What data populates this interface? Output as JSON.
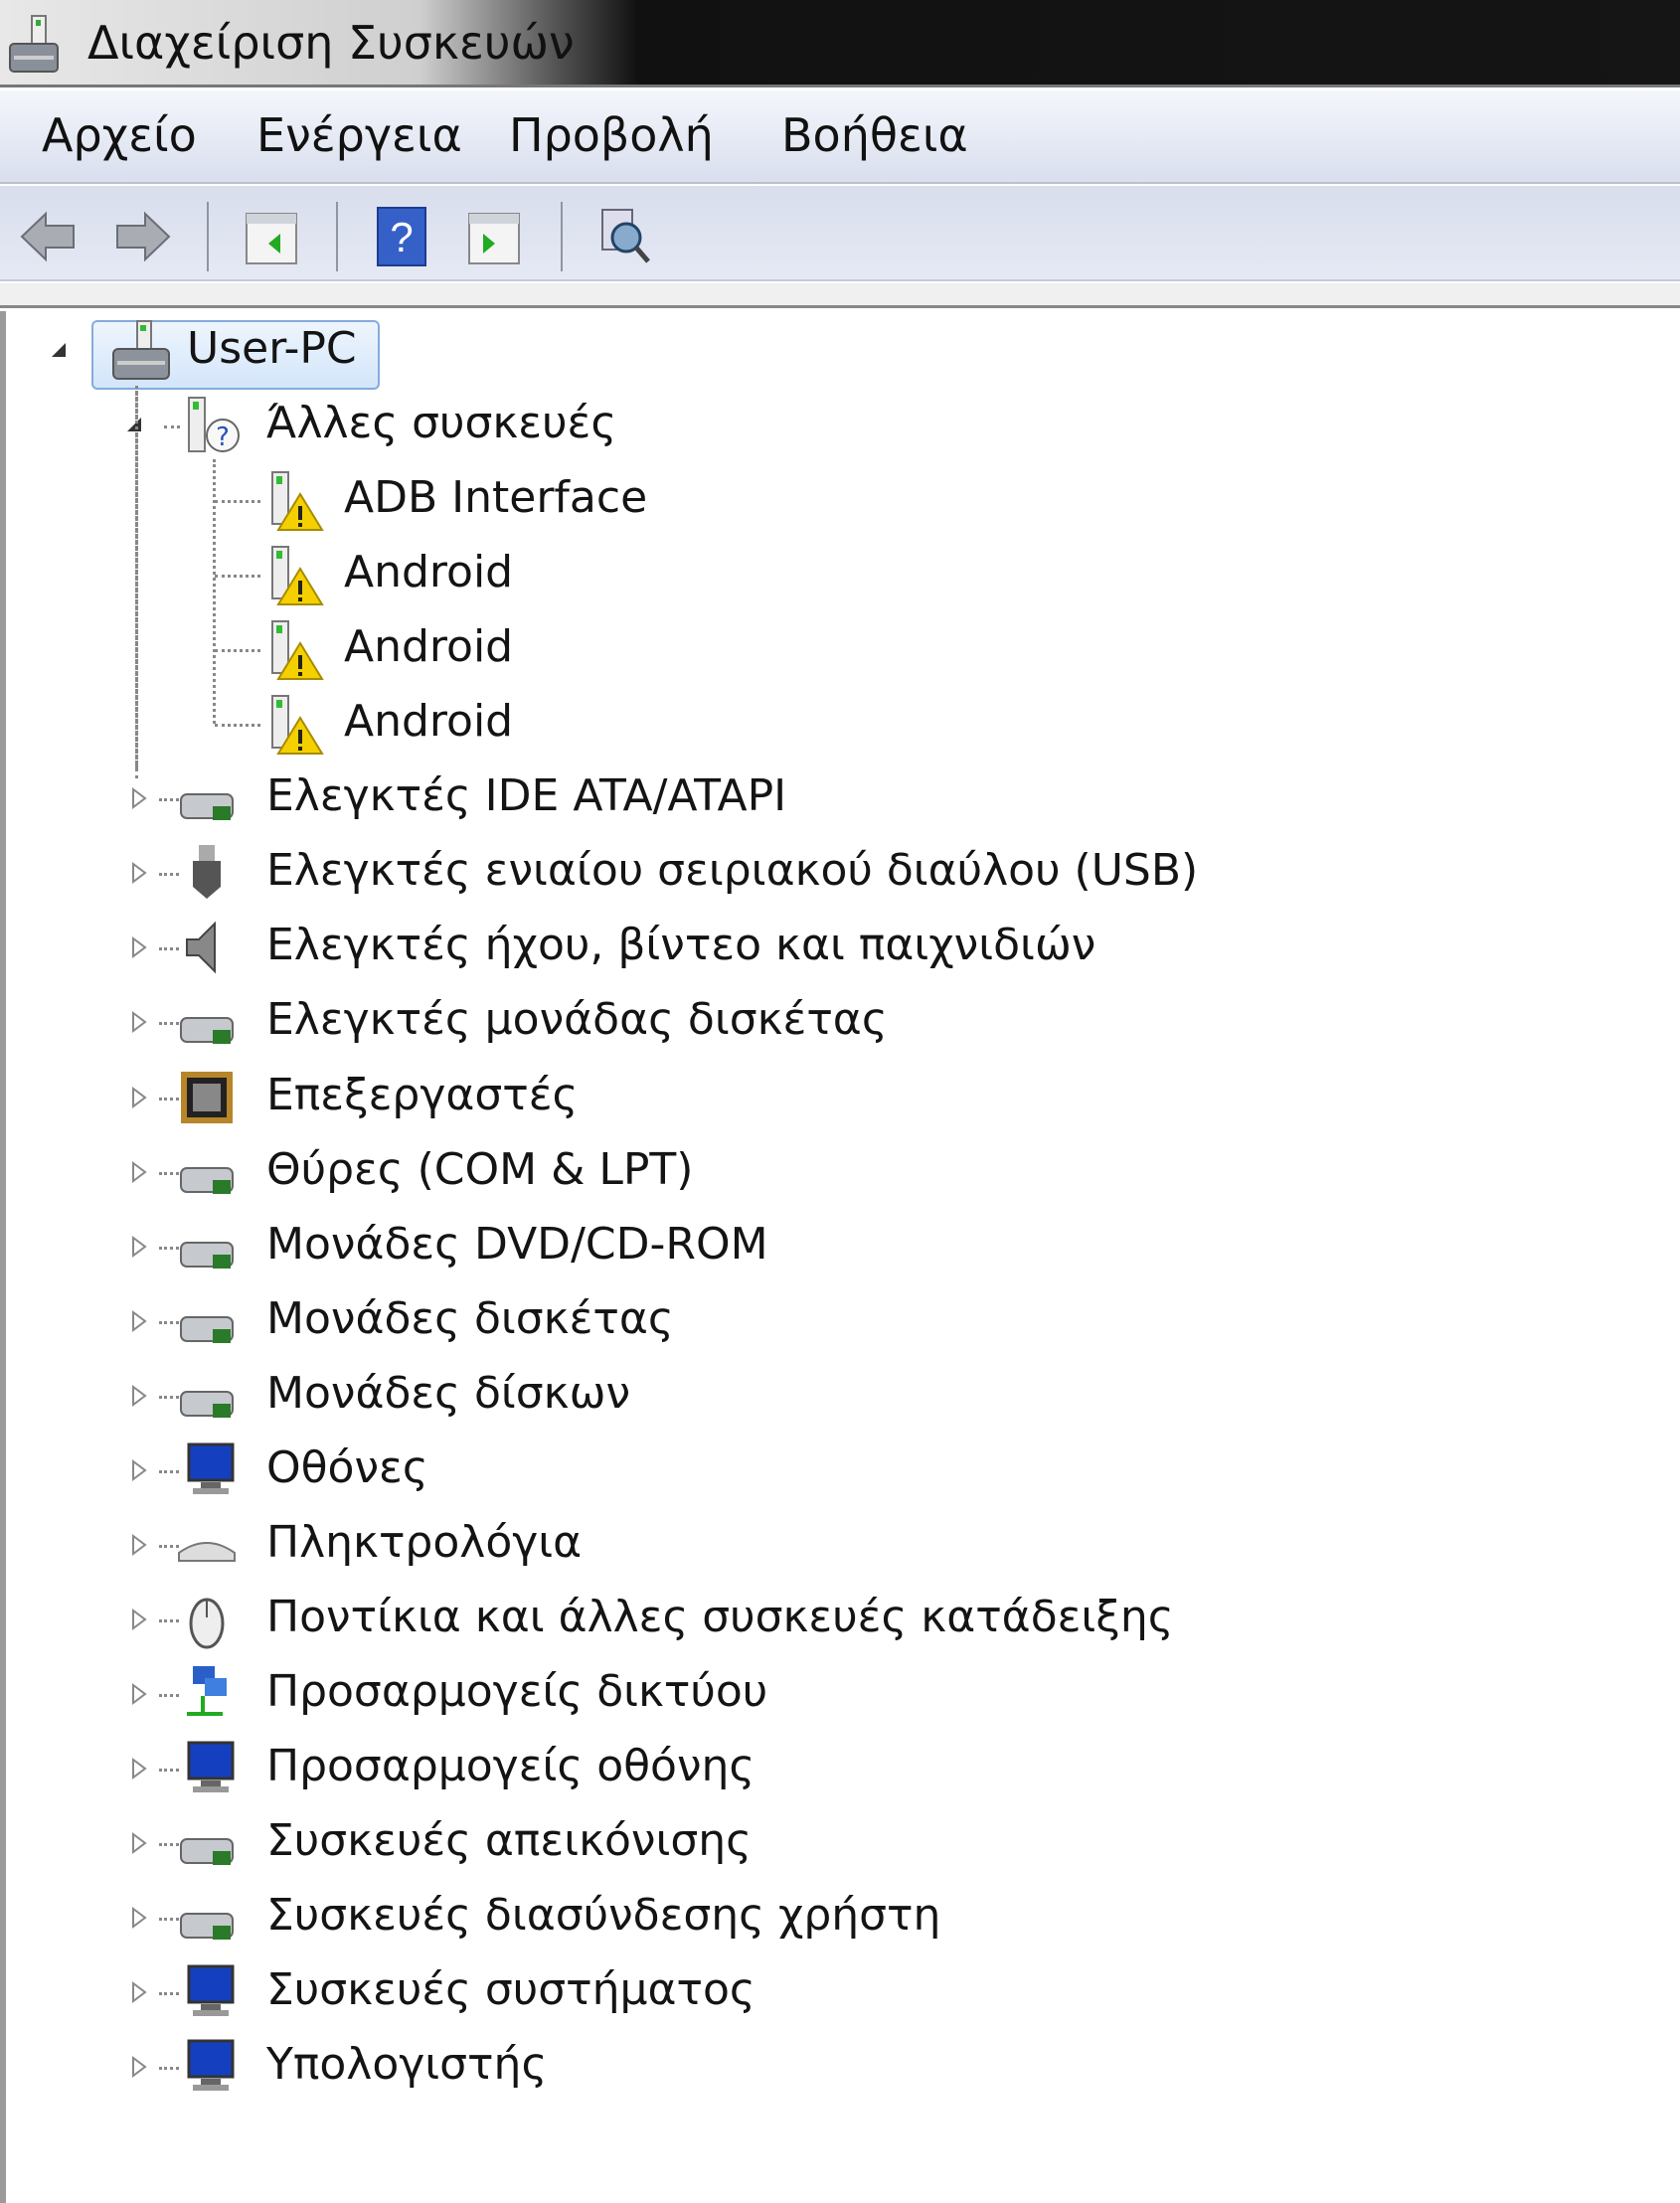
{
  "window": {
    "title": "Διαχείριση Συσκευών"
  },
  "menu": [
    "Αρχείο",
    "Ενέργεια",
    "Προβολή",
    "Βοήθεια"
  ],
  "toolbar": [
    "back-icon",
    "forward-icon",
    "show-hide-console-tree-icon",
    "help-icon",
    "show-hide-action-pane-icon",
    "scan-hardware-changes-icon"
  ],
  "tree": {
    "root": "User-PC",
    "other": {
      "label": "Άλλες συσκευές",
      "children": [
        "ADB Interface",
        "Android",
        "Android",
        "Android"
      ]
    },
    "categories": [
      {
        "label": "Ελεγκτές IDE ATA/ATAPI",
        "icon": "ide-controller-icon"
      },
      {
        "label": "Ελεγκτές ενιαίου σειριακού διαύλου (USB)",
        "icon": "usb-icon"
      },
      {
        "label": "Ελεγκτές ήχου, βίντεο και παιχνιδιών",
        "icon": "speaker-icon"
      },
      {
        "label": "Ελεγκτές μονάδας δισκέτας",
        "icon": "floppy-controller-icon"
      },
      {
        "label": "Επεξεργαστές",
        "icon": "processor-icon"
      },
      {
        "label": "Θύρες (COM & LPT)",
        "icon": "port-icon"
      },
      {
        "label": "Μονάδες DVD/CD-ROM",
        "icon": "dvd-drive-icon"
      },
      {
        "label": "Μονάδες δισκέτας",
        "icon": "floppy-drive-icon"
      },
      {
        "label": "Μονάδες δίσκων",
        "icon": "disk-drive-icon"
      },
      {
        "label": "Οθόνες",
        "icon": "monitor-icon"
      },
      {
        "label": "Πληκτρολόγια",
        "icon": "keyboard-icon"
      },
      {
        "label": "Ποντίκια και άλλες συσκευές κατάδειξης",
        "icon": "mouse-icon"
      },
      {
        "label": "Προσαρμογείς δικτύου",
        "icon": "network-adapter-icon"
      },
      {
        "label": "Προσαρμογείς οθόνης",
        "icon": "display-adapter-icon"
      },
      {
        "label": "Συσκευές απεικόνισης",
        "icon": "imaging-device-icon"
      },
      {
        "label": "Συσκευές διασύνδεσης χρήστη",
        "icon": "hid-icon"
      },
      {
        "label": "Συσκευές συστήματος",
        "icon": "system-device-icon"
      },
      {
        "label": "Υπολογιστής",
        "icon": "computer-icon"
      }
    ]
  }
}
